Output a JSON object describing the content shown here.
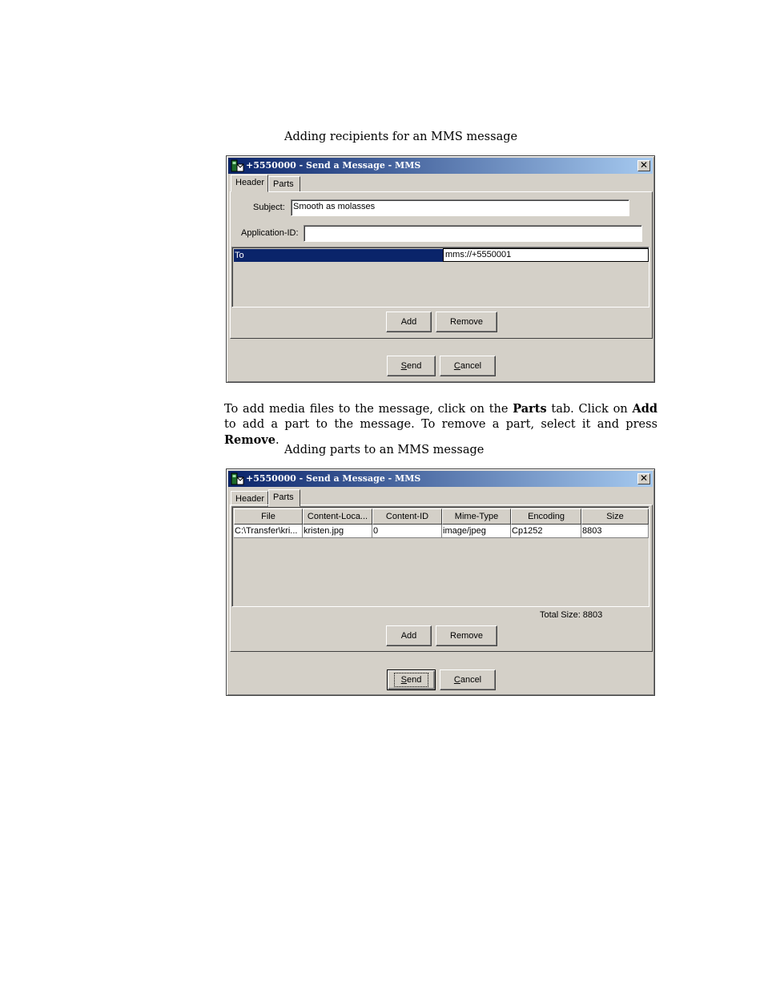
{
  "captions": {
    "first": "Adding recipients for an MMS message",
    "second": "Adding parts to an MMS message"
  },
  "paragraph": {
    "t1": "To add media files to the message, click on the ",
    "b1": "Parts",
    "t2": " tab. Click on ",
    "b2": "Add",
    "t3": " to add a part to the message. To remove a part, select it and press ",
    "b3": "Remove",
    "t4": "."
  },
  "window": {
    "title": "+5550000 - Send a Message - MMS",
    "close_glyph": "✕",
    "tab_header": "Header",
    "tab_parts": "Parts",
    "add_label": "Add",
    "remove_label": "Remove",
    "send_mnemonic": "S",
    "send_rest": "end",
    "cancel_mnemonic": "C",
    "cancel_rest": "ancel"
  },
  "header_tab": {
    "subject_label": "Subject:",
    "subject_value": "Smooth as molasses",
    "appid_label": "Application-ID:",
    "appid_value": "",
    "recipient_type": "To",
    "recipient_address": "mms://+5550001"
  },
  "parts_tab": {
    "columns": [
      "File",
      "Content-Loca...",
      "Content-ID",
      "Mime-Type",
      "Encoding",
      "Size"
    ],
    "rows": [
      [
        "C:\\Transfer\\kri...",
        "kristen.jpg",
        "0",
        "image/jpeg",
        "Cp1252",
        "8803"
      ]
    ],
    "total_size": "Total Size: 8803"
  },
  "icons": {
    "app": "phone-message-icon",
    "close": "close-icon"
  }
}
